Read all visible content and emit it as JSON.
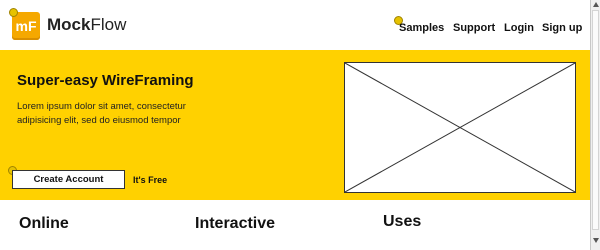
{
  "header": {
    "logo_badge": "mF",
    "logo_brand_bold": "Mock",
    "logo_brand_light": "Flow",
    "nav": [
      {
        "label": "Samples"
      },
      {
        "label": "Support"
      },
      {
        "label": "Login"
      },
      {
        "label": "Sign up"
      }
    ]
  },
  "hero": {
    "title": "Super-easy WireFraming",
    "description": "Lorem ipsum dolor sit amet, consectetur adipisicing elit, sed do eiusmod tempor",
    "create_button": "Create Account",
    "free_label": "It's Free",
    "image_placeholder": "image-placeholder"
  },
  "features": [
    {
      "title": "Online"
    },
    {
      "title": "Interactive"
    },
    {
      "title": "Uses"
    }
  ],
  "colors": {
    "hero_bg": "#ffd100",
    "logo_badge": "#f5a800",
    "pin": "#e6c200"
  }
}
